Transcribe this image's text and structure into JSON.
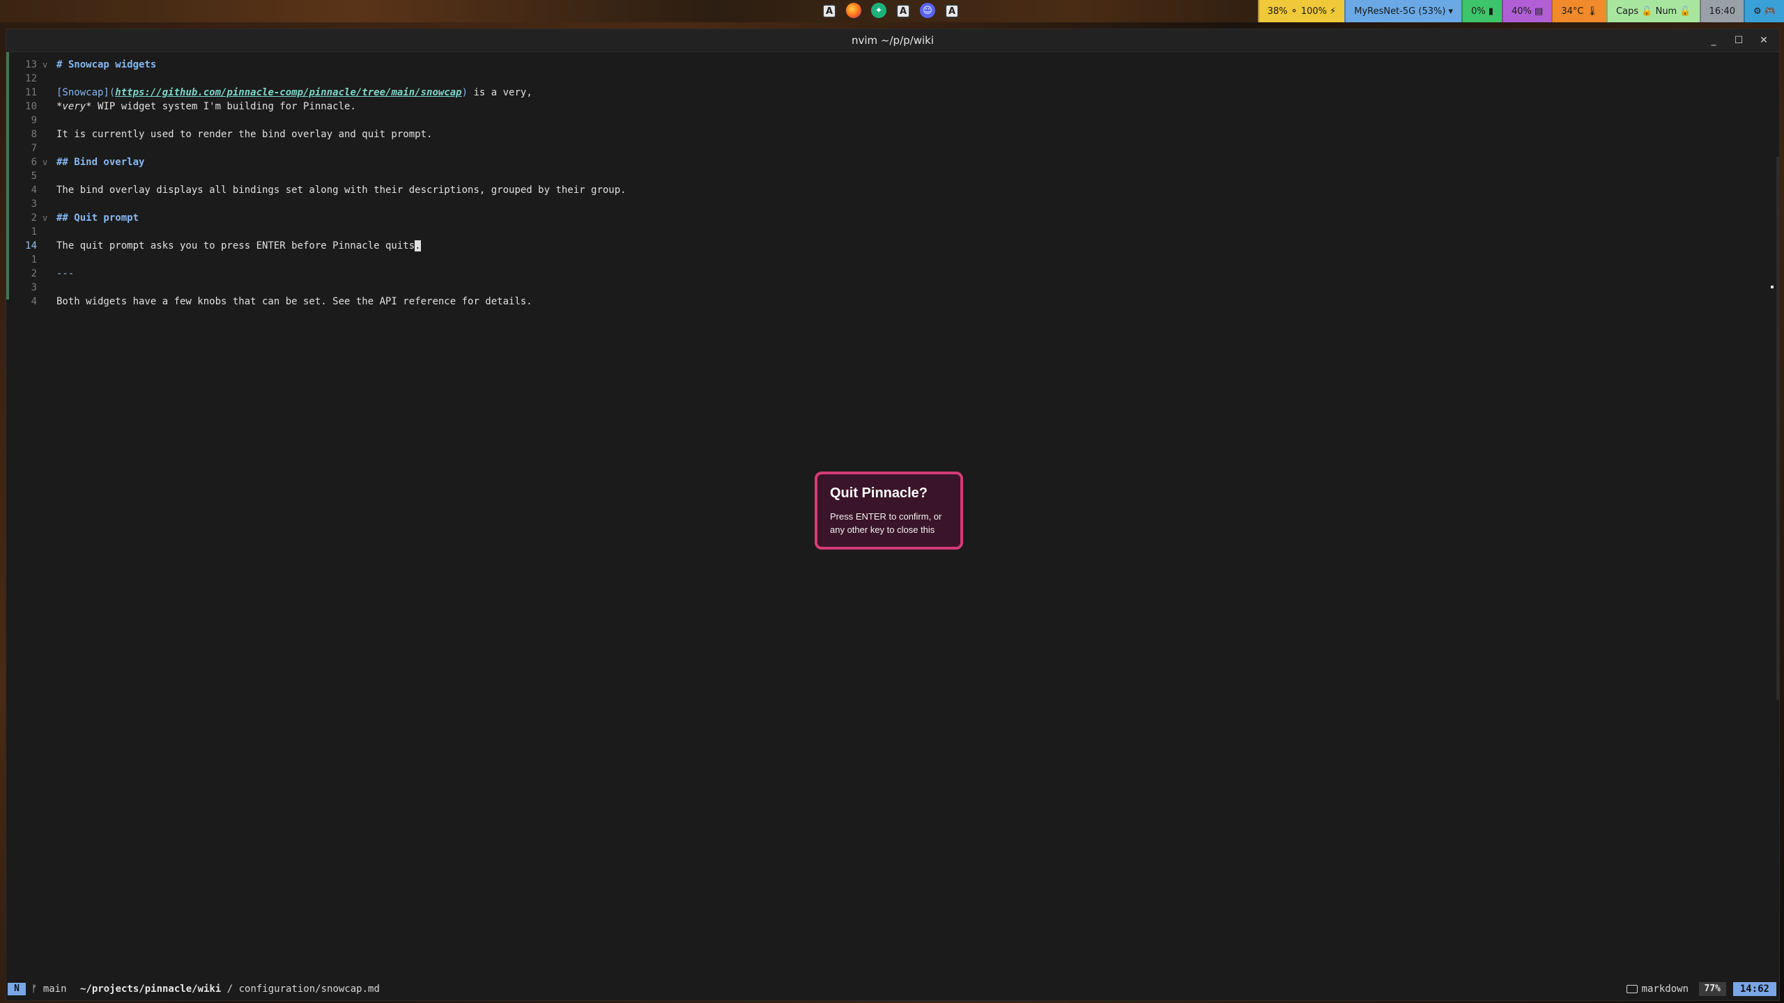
{
  "topbar": {
    "tray_icons": [
      {
        "name": "app-a-icon",
        "glyph": "A",
        "kind": "box"
      },
      {
        "name": "firefox-icon",
        "glyph": "",
        "kind": "fox"
      },
      {
        "name": "green-app-icon",
        "glyph": "✦",
        "kind": "green"
      },
      {
        "name": "app-a-icon",
        "glyph": "A",
        "kind": "box"
      },
      {
        "name": "discord-icon",
        "glyph": "☺",
        "kind": "disc"
      },
      {
        "name": "app-a-icon",
        "glyph": "A",
        "kind": "box"
      }
    ],
    "widgets": [
      {
        "name": "battery-widget",
        "label": "38% ⚬ 100% ⚡",
        "color": "#f0c93a"
      },
      {
        "name": "network-widget",
        "label": "MyResNet-5G (53%) ▾",
        "color": "#6aa9e6"
      },
      {
        "name": "cpu-widget",
        "label": "0% ▮",
        "color": "#3ec46a"
      },
      {
        "name": "memory-widget",
        "label": "40% ▤",
        "color": "#b05fd6"
      },
      {
        "name": "temperature-widget",
        "label": "34°C 🌡",
        "color": "#f08a2a"
      },
      {
        "name": "keyboard-locks-widget",
        "label": "Caps 🔓  Num 🔓",
        "color": "#a8e6a0"
      },
      {
        "name": "clock-widget",
        "label": "16:40",
        "color": "#9aa0a8"
      },
      {
        "name": "notification-widget",
        "label": "⚙ 🎮",
        "color": "#3aa0d8"
      }
    ]
  },
  "window": {
    "title": "nvim ~/p/p/wiki",
    "buttons": {
      "minimize": "_",
      "maximize": "☐",
      "close": "✕"
    }
  },
  "editor": {
    "lines": [
      {
        "num": "13",
        "fold": "v",
        "segments": [
          {
            "text": "# Snowcap widgets",
            "cls": "h"
          }
        ]
      },
      {
        "num": "12",
        "fold": "",
        "segments": []
      },
      {
        "num": "11",
        "fold": "",
        "segments": [
          {
            "text": "[Snowcap](",
            "cls": "bracket"
          },
          {
            "text": "https://github.com/pinnacle-comp/pinnacle/tree/main/snowcap",
            "cls": "link"
          },
          {
            "text": ")",
            "cls": "bracket"
          },
          {
            "text": " is a very,",
            "cls": ""
          }
        ]
      },
      {
        "num": "10",
        "fold": "",
        "segments": [
          {
            "text": "*very*",
            "cls": "it"
          },
          {
            "text": " WIP widget system I'm building for Pinnacle.",
            "cls": ""
          }
        ]
      },
      {
        "num": "9",
        "fold": "",
        "segments": []
      },
      {
        "num": "8",
        "fold": "",
        "segments": [
          {
            "text": "It is currently used to render the bind overlay and quit prompt.",
            "cls": ""
          }
        ]
      },
      {
        "num": "7",
        "fold": "",
        "segments": []
      },
      {
        "num": "6",
        "fold": "v",
        "segments": [
          {
            "text": "## Bind overlay",
            "cls": "h"
          }
        ]
      },
      {
        "num": "5",
        "fold": "",
        "segments": []
      },
      {
        "num": "4",
        "fold": "",
        "segments": [
          {
            "text": "The bind overlay displays all bindings set along with their descriptions, grouped by their group.",
            "cls": ""
          }
        ]
      },
      {
        "num": "3",
        "fold": "",
        "segments": []
      },
      {
        "num": "2",
        "fold": "v",
        "segments": [
          {
            "text": "## Quit prompt",
            "cls": "h"
          }
        ]
      },
      {
        "num": "1",
        "fold": "",
        "segments": []
      },
      {
        "num": "14",
        "fold": "",
        "current": true,
        "segments": [
          {
            "text": "The quit prompt asks you to press ENTER before Pinnacle quits",
            "cls": ""
          },
          {
            "text": ".",
            "cls": "cursor"
          }
        ]
      },
      {
        "num": "1",
        "fold": "",
        "segments": []
      },
      {
        "num": "2",
        "fold": "",
        "segments": [
          {
            "text": "---",
            "cls": "hr"
          }
        ]
      },
      {
        "num": "3",
        "fold": "",
        "segments": []
      },
      {
        "num": "4",
        "fold": "",
        "segments": [
          {
            "text": "Both widgets have a few knobs that can be set. See the API reference for details.",
            "cls": ""
          }
        ]
      }
    ]
  },
  "dialog": {
    "title": "Quit Pinnacle?",
    "body": "Press ENTER to confirm, or any other key to close this"
  },
  "statusline": {
    "mode": "N",
    "branch": "ᚠ main",
    "cwd": "~/projects/pinnacle/wiki",
    "separator": " / ",
    "file": "configuration/snowcap.md",
    "filetype": "markdown",
    "percent": "77%",
    "position": "14:62"
  }
}
